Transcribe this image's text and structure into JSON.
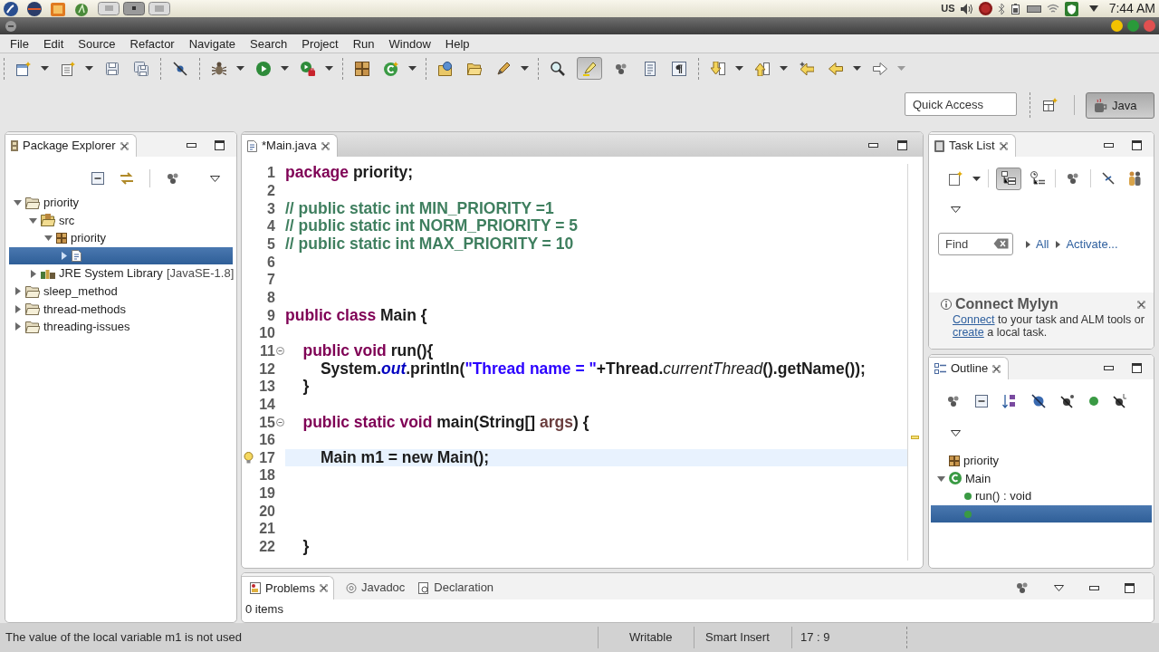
{
  "system_bar": {
    "keyboard": "US",
    "clock": "7:44 AM"
  },
  "menu_bar": [
    "File",
    "Edit",
    "Source",
    "Refactor",
    "Navigate",
    "Search",
    "Project",
    "Run",
    "Window",
    "Help"
  ],
  "toolbar": [
    {
      "kind": "new",
      "dropdown": true,
      "pressed": false
    },
    {
      "kind": "newfile",
      "dropdown": true,
      "pressed": false
    },
    {
      "kind": "save",
      "dropdown": false,
      "pressed": false
    },
    {
      "kind": "saveall",
      "dropdown": false,
      "pressed": false
    },
    {
      "kind": "separator"
    },
    {
      "kind": "skip",
      "dropdown": false,
      "pressed": false
    },
    {
      "kind": "separator"
    },
    {
      "kind": "debug",
      "dropdown": true,
      "pressed": false
    },
    {
      "kind": "run",
      "dropdown": true,
      "pressed": false
    },
    {
      "kind": "external",
      "dropdown": true,
      "pressed": false
    },
    {
      "kind": "separator"
    },
    {
      "kind": "package",
      "dropdown": false,
      "pressed": false
    },
    {
      "kind": "class",
      "dropdown": true,
      "pressed": false
    },
    {
      "kind": "separator"
    },
    {
      "kind": "opentype",
      "dropdown": false,
      "pressed": false
    },
    {
      "kind": "openfolder",
      "dropdown": false,
      "pressed": false
    },
    {
      "kind": "pen",
      "dropdown": true,
      "pressed": false
    },
    {
      "kind": "separator"
    },
    {
      "kind": "search",
      "dropdown": false,
      "pressed": false
    },
    {
      "kind": "mark",
      "dropdown": false,
      "pressed": true
    },
    {
      "kind": "occurrences",
      "dropdown": false,
      "pressed": false
    },
    {
      "kind": "block",
      "dropdown": false,
      "pressed": false
    },
    {
      "kind": "whitespace",
      "dropdown": false,
      "pressed": false
    },
    {
      "kind": "separator"
    },
    {
      "kind": "nextann",
      "dropdown": true,
      "pressed": false
    },
    {
      "kind": "prevann",
      "dropdown": true,
      "pressed": false
    },
    {
      "kind": "lastedit",
      "dropdown": false,
      "pressed": false
    },
    {
      "kind": "back",
      "dropdown": true,
      "pressed": false
    },
    {
      "kind": "forward",
      "dropdown": true,
      "pressed": false
    }
  ],
  "quick_access": {
    "placeholder": "Quick Access"
  },
  "perspectives": [
    {
      "label": "Java",
      "selected": true
    }
  ],
  "package_explorer": {
    "title": "Package Explorer",
    "tree": [
      {
        "label": "priority",
        "kind": "project",
        "expanded": true,
        "selected": false,
        "children": [
          {
            "label": "src",
            "kind": "source_folder",
            "expanded": true,
            "selected": false,
            "children": [
              {
                "label": "priority",
                "kind": "package",
                "expanded": true,
                "selected": false,
                "children": [
                  {
                    "kind": "file",
                    "expanded": false,
                    "selected": true
                  }
                ]
              }
            ]
          },
          {
            "label": "JRE System Library",
            "decoration": "[JavaSE-1.8]",
            "kind": "library",
            "expanded": false,
            "selected": false
          }
        ]
      },
      {
        "label": "sleep_method",
        "kind": "project",
        "expanded": false,
        "selected": false
      },
      {
        "label": "thread-methods",
        "kind": "project",
        "expanded": false,
        "selected": false
      },
      {
        "label": "threading-issues",
        "kind": "project",
        "expanded": false,
        "selected": false
      }
    ]
  },
  "editor": {
    "tabs": [
      {
        "label": "*Main.java",
        "selected": true
      }
    ],
    "lines": [
      {
        "number": "1",
        "current": false,
        "foldable": false,
        "warning": false,
        "tokens": [
          {
            "kind": "keyword",
            "text": "package "
          },
          {
            "kind": "plain",
            "text": "priority;"
          }
        ]
      },
      {
        "number": "2",
        "current": false,
        "foldable": false,
        "warning": false
      },
      {
        "number": "3",
        "current": false,
        "foldable": false,
        "warning": false,
        "tokens": [
          {
            "kind": "comment",
            "text": "// public static int MIN_PRIORITY =1"
          }
        ]
      },
      {
        "number": "4",
        "current": false,
        "foldable": false,
        "warning": false,
        "tokens": [
          {
            "kind": "comment",
            "text": "// public static int NORM_PRIORITY = 5"
          }
        ]
      },
      {
        "number": "5",
        "current": false,
        "foldable": false,
        "warning": false,
        "tokens": [
          {
            "kind": "comment",
            "text": "// public static int MAX_PRIORITY = 10"
          }
        ]
      },
      {
        "number": "6",
        "current": false,
        "foldable": false,
        "warning": false
      },
      {
        "number": "7",
        "current": false,
        "foldable": false,
        "warning": false
      },
      {
        "number": "8",
        "current": false,
        "foldable": false,
        "warning": false
      },
      {
        "number": "9",
        "current": false,
        "foldable": false,
        "warning": false,
        "tokens": [
          {
            "kind": "keyword",
            "text": "public class "
          },
          {
            "kind": "plain",
            "text": "Main {"
          }
        ]
      },
      {
        "number": "10",
        "current": false,
        "foldable": false,
        "warning": false
      },
      {
        "number": "11",
        "current": false,
        "foldable": true,
        "warning": false,
        "tokens": [
          {
            "kind": "keyword",
            "text": "    public void "
          },
          {
            "kind": "plain",
            "text": "run(){"
          }
        ]
      },
      {
        "number": "12",
        "current": false,
        "foldable": false,
        "warning": false,
        "tokens": [
          {
            "kind": "plain",
            "text": "        System."
          },
          {
            "kind": "field",
            "text": "out"
          },
          {
            "kind": "plain",
            "text": ".println("
          },
          {
            "kind": "string",
            "text": "\"Thread name = \""
          },
          {
            "kind": "plain",
            "text": "+Thread."
          },
          {
            "kind": "static",
            "text": "currentThread"
          },
          {
            "kind": "plain",
            "text": "().getName());"
          }
        ]
      },
      {
        "number": "13",
        "current": false,
        "foldable": false,
        "warning": false,
        "tokens": [
          {
            "kind": "plain",
            "text": "    }"
          }
        ]
      },
      {
        "number": "14",
        "current": false,
        "foldable": false,
        "warning": false
      },
      {
        "number": "15",
        "current": false,
        "foldable": true,
        "warning": false,
        "tokens": [
          {
            "kind": "keyword",
            "text": "    public static void "
          },
          {
            "kind": "plain",
            "text": "main(String[] "
          },
          {
            "kind": "param",
            "text": "args"
          },
          {
            "kind": "plain",
            "text": ") {"
          }
        ]
      },
      {
        "number": "16",
        "current": false,
        "foldable": false,
        "warning": false
      },
      {
        "number": "17",
        "current": true,
        "foldable": false,
        "warning": true,
        "tokens": [
          {
            "kind": "plain",
            "text": "        Main m1 = new Main();"
          }
        ]
      },
      {
        "number": "18",
        "current": false,
        "foldable": false,
        "warning": false
      },
      {
        "number": "19",
        "current": false,
        "foldable": false,
        "warning": false
      },
      {
        "number": "20",
        "current": false,
        "foldable": false,
        "warning": false
      },
      {
        "number": "21",
        "current": false,
        "foldable": false,
        "warning": false
      },
      {
        "number": "22",
        "current": false,
        "foldable": false,
        "warning": false,
        "tokens": [
          {
            "kind": "plain",
            "text": "    }"
          }
        ]
      }
    ]
  },
  "task_list": {
    "title": "Task List",
    "toolbar": [
      {
        "kind": "newtask",
        "dropdown": true,
        "pressed": false
      },
      {
        "kind": "separator"
      },
      {
        "kind": "categorized",
        "dropdown": false,
        "pressed": true
      },
      {
        "kind": "scheduled",
        "dropdown": false,
        "pressed": false
      },
      {
        "kind": "separator"
      },
      {
        "kind": "focus",
        "dropdown": false,
        "pressed": false
      },
      {
        "kind": "separator"
      },
      {
        "kind": "collapse",
        "dropdown": false,
        "pressed": false
      },
      {
        "kind": "people",
        "dropdown": false,
        "pressed": false
      }
    ],
    "find": {
      "placeholder": "Find"
    },
    "filters": [
      "All",
      "Activate..."
    ]
  },
  "connect_mylyn": {
    "title": "Connect Mylyn",
    "message": [
      {
        "kind": "link",
        "text": "Connect"
      },
      {
        "kind": "text",
        "text": " to your task and ALM tools or "
      },
      {
        "kind": "link",
        "text": "create"
      },
      {
        "kind": "text",
        "text": " a local task."
      }
    ]
  },
  "outline": {
    "title": "Outline",
    "tree": [
      {
        "label": "priority",
        "kind": "package",
        "selected": false
      },
      {
        "label": "Main",
        "kind": "class",
        "expanded": true,
        "selected": false,
        "children": [
          {
            "label": "run() : void",
            "kind": "method",
            "selected": false
          },
          {
            "kind": "method",
            "selected": true
          }
        ]
      }
    ]
  },
  "bottom_panel": {
    "tabs": [
      {
        "label": "Problems",
        "kind": "problems",
        "selected": true
      },
      {
        "label": "Javadoc",
        "kind": "javadoc",
        "selected": false
      },
      {
        "label": "Declaration",
        "kind": "declaration",
        "selected": false
      }
    ],
    "summary": "0 items"
  },
  "status_bar": {
    "message": "The value of the local variable m1 is not used",
    "fields": [
      "Writable",
      "Smart Insert",
      "17 : 9"
    ]
  }
}
